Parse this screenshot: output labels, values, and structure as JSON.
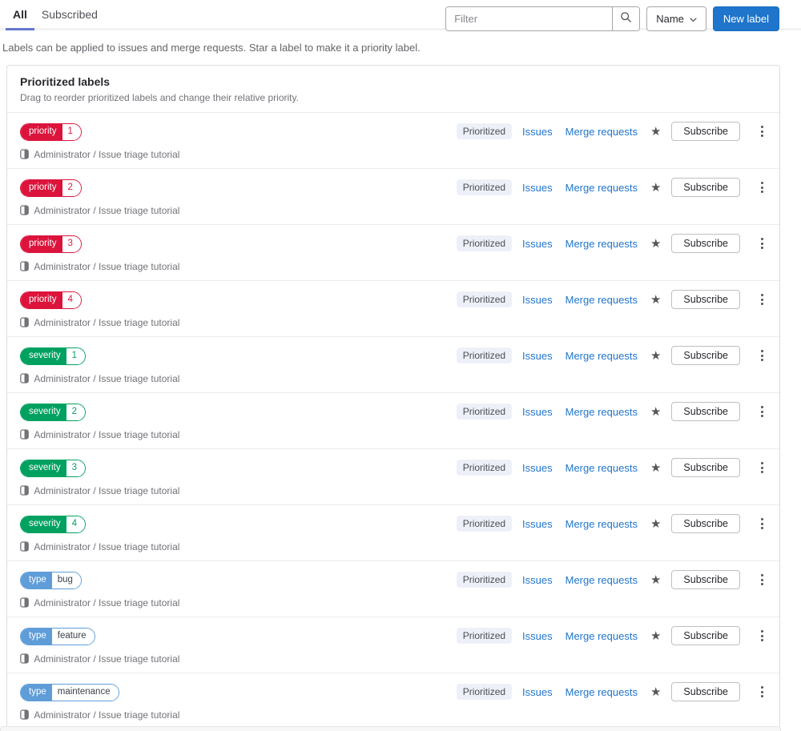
{
  "tabs": [
    {
      "label": "All",
      "active": true
    },
    {
      "label": "Subscribed",
      "active": false
    }
  ],
  "toolbar": {
    "filter_placeholder": "Filter",
    "sort_label": "Name",
    "new_label_button": "New label"
  },
  "description": "Labels can be applied to issues and merge requests. Star a label to make it a priority label.",
  "card": {
    "title": "Prioritized labels",
    "subtitle": "Drag to reorder prioritized labels and change their relative priority."
  },
  "row_common": {
    "project": "Administrator / Issue triage tutorial",
    "prioritized_badge": "Prioritized",
    "issues_link": "Issues",
    "merge_requests_link": "Merge requests",
    "subscribe_button": "Subscribe"
  },
  "labels": [
    {
      "scope": "priority",
      "value": "1",
      "color": "#dc143c",
      "value_color": "#dc143c"
    },
    {
      "scope": "priority",
      "value": "2",
      "color": "#dc143c",
      "value_color": "#dc143c"
    },
    {
      "scope": "priority",
      "value": "3",
      "color": "#dc143c",
      "value_color": "#dc143c"
    },
    {
      "scope": "priority",
      "value": "4",
      "color": "#dc143c",
      "value_color": "#dc143c"
    },
    {
      "scope": "severity",
      "value": "1",
      "color": "#00a160",
      "value_color": "#00a160"
    },
    {
      "scope": "severity",
      "value": "2",
      "color": "#00a160",
      "value_color": "#00a160"
    },
    {
      "scope": "severity",
      "value": "3",
      "color": "#00a160",
      "value_color": "#00a160"
    },
    {
      "scope": "severity",
      "value": "4",
      "color": "#00a160",
      "value_color": "#00a160"
    },
    {
      "scope": "type",
      "value": "bug",
      "color": "#5f9dd8",
      "value_color": "#3a424a"
    },
    {
      "scope": "type",
      "value": "feature",
      "color": "#5f9dd8",
      "value_color": "#3a424a"
    },
    {
      "scope": "type",
      "value": "maintenance",
      "color": "#5f9dd8",
      "value_color": "#3a424a"
    }
  ],
  "icons": {
    "star_glyph": "★",
    "search": "magnifier",
    "chevron": "chevron-down",
    "kebab": "vertical-ellipsis",
    "project": "half-filled-project"
  },
  "colors": {
    "accent_blue": "#1f75cb",
    "link_blue": "#1f75cb",
    "tab_indicator": "#6577cf",
    "badge_bg": "#edf1f7"
  }
}
